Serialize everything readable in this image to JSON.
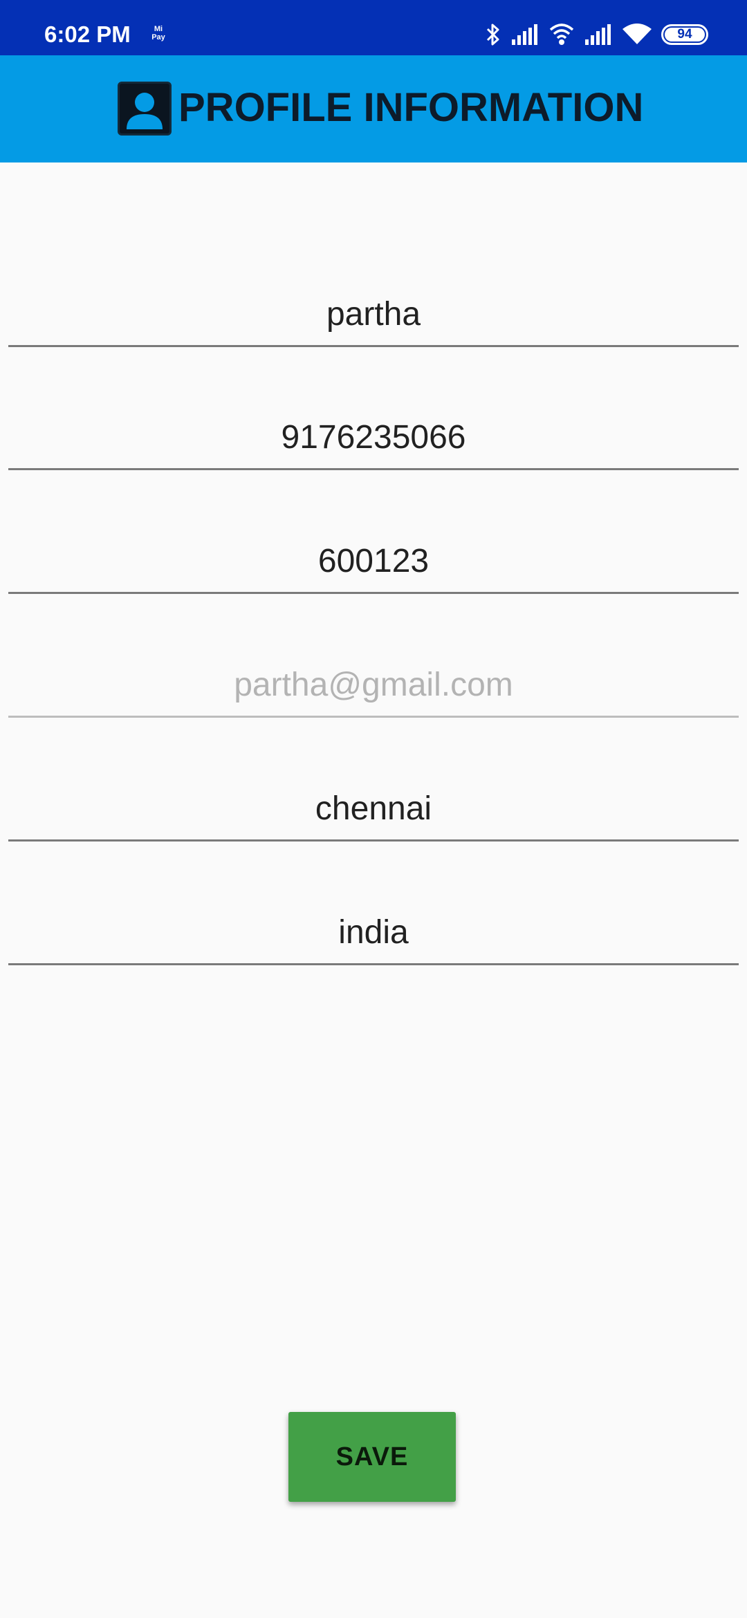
{
  "status_bar": {
    "time": "6:02 PM",
    "mipay_label": "Mi Pay",
    "battery": "94",
    "icons": [
      "bluetooth-icon",
      "signal-icon",
      "wifi-calling-icon",
      "signal-icon",
      "wifi-icon",
      "battery-icon"
    ]
  },
  "app_bar": {
    "title": "PROFILE INFORMATION",
    "icon": "profile-icon",
    "background": "#049be5"
  },
  "form": {
    "name": "partha",
    "phone": "9176235066",
    "pincode": "600123",
    "email_placeholder": "partha@gmail.com",
    "city": "chennai",
    "country": "india"
  },
  "save_button": {
    "label": "SAVE",
    "color": "#43a047"
  },
  "colors": {
    "status_bar": "#0430b5",
    "app_bar": "#049be5",
    "background": "#fafafa"
  }
}
